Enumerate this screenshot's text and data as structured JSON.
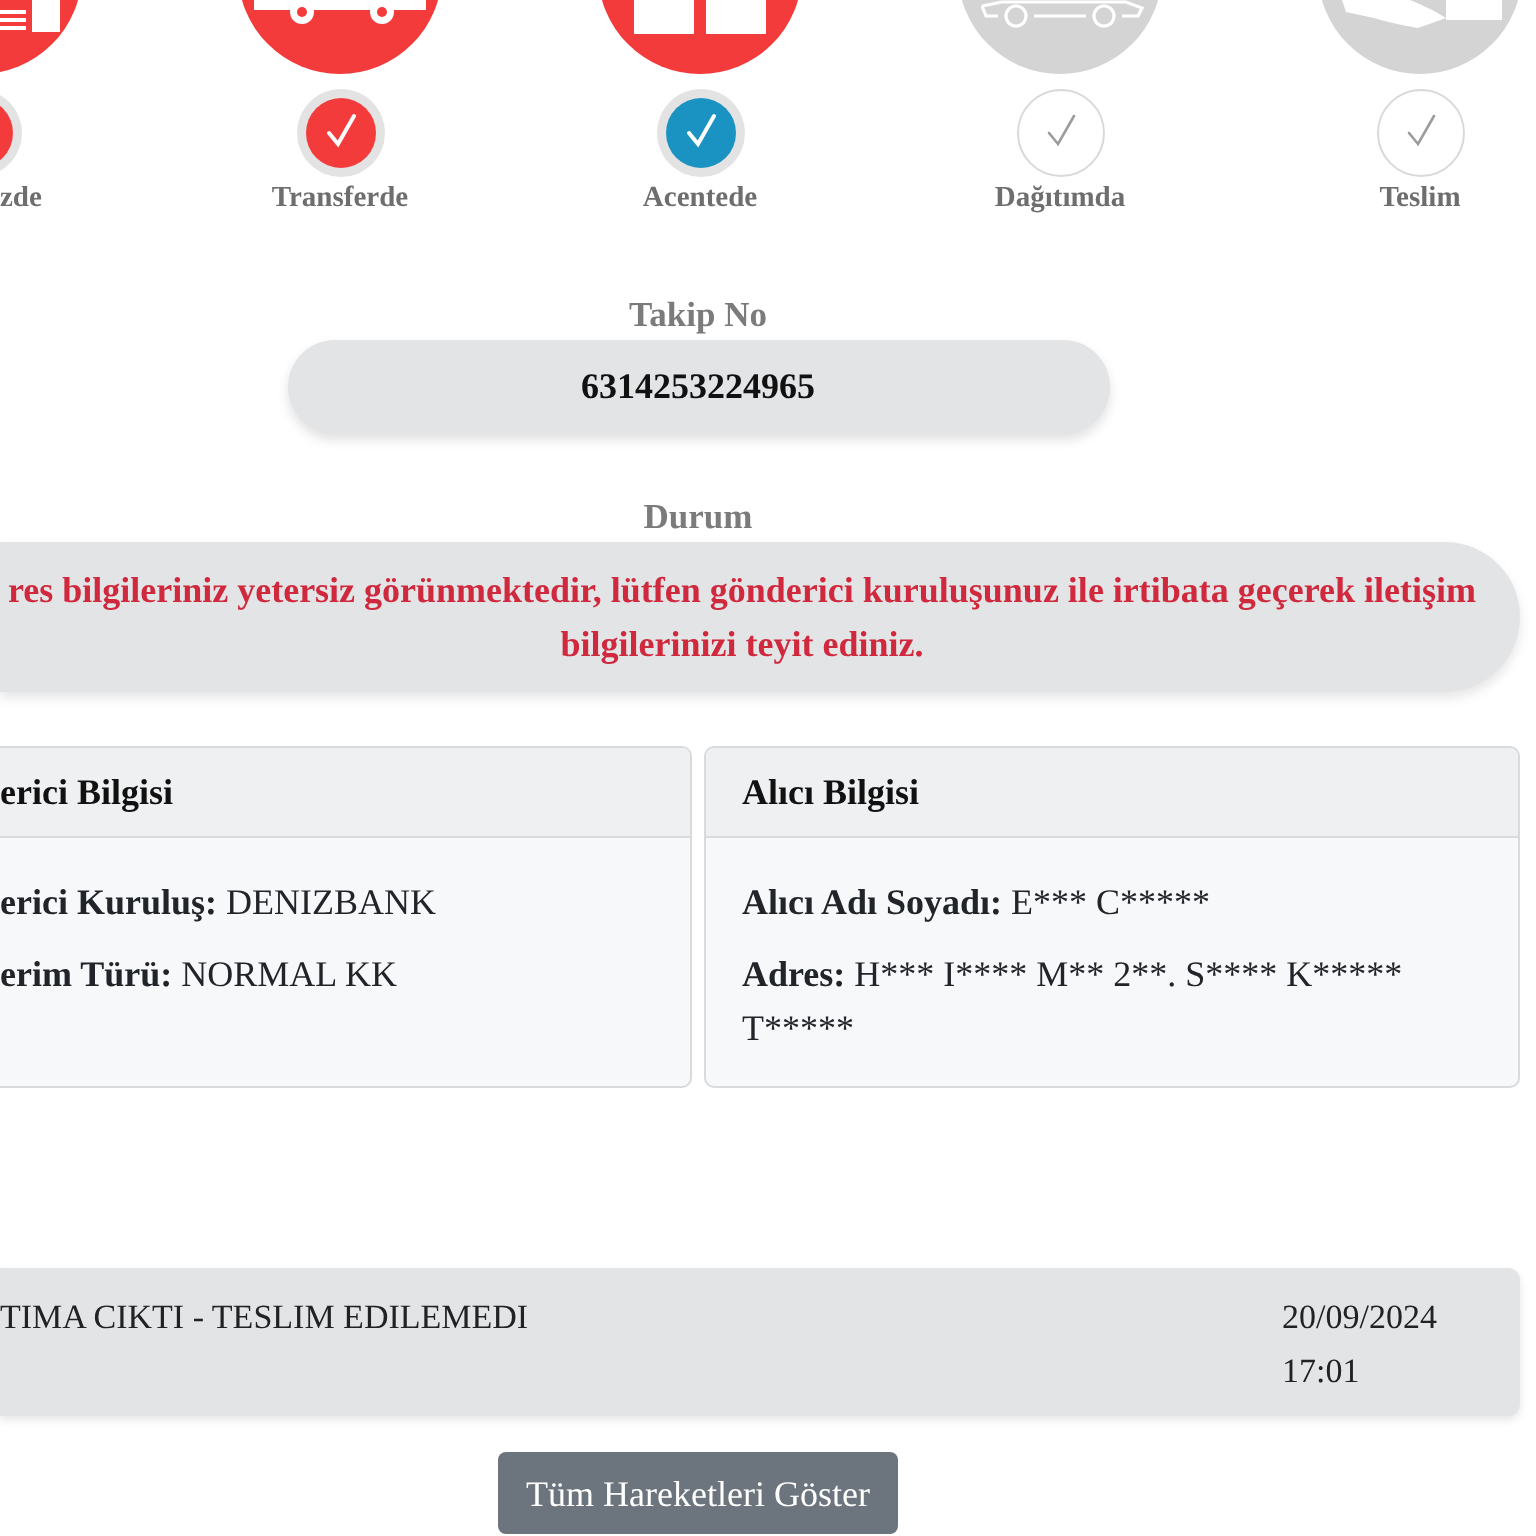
{
  "steps": [
    {
      "label": "zde",
      "kind": "done"
    },
    {
      "label": "Transferde",
      "kind": "done"
    },
    {
      "label": "Acentede",
      "kind": "current"
    },
    {
      "label": "Dağıtımda",
      "kind": "pending"
    },
    {
      "label": "Teslim",
      "kind": "pending"
    }
  ],
  "tracking": {
    "label": "Takip No",
    "value": "6314253224965"
  },
  "status": {
    "label": "Durum",
    "message": "res bilgileriniz yetersiz görünmektedir, lütfen gönderici kuruluşunuz ile irtibata geçerek iletişim bilgilerinizi teyit ediniz."
  },
  "cards": [
    {
      "title": "erici Bilgisi",
      "fields": [
        {
          "label": "erici Kuruluş:",
          "value": "DENIZBANK"
        },
        {
          "label": "erim Türü:",
          "value": "NORMAL KK"
        }
      ]
    },
    {
      "title": "Alıcı Bilgisi",
      "fields": [
        {
          "label": "Alıcı Adı Soyadı:",
          "value": "E*** C*****"
        },
        {
          "label": "Adres:",
          "value": "H*** I**** M** 2**. S**** K***** T*****"
        }
      ]
    }
  ],
  "movements": [
    {
      "description": "TIMA CIKTI - TESLIM EDILEMEDI",
      "date_time": "20/09/2024 17:01"
    }
  ],
  "buttons": [
    {
      "label": "Tüm Hareketleri Göster"
    }
  ]
}
